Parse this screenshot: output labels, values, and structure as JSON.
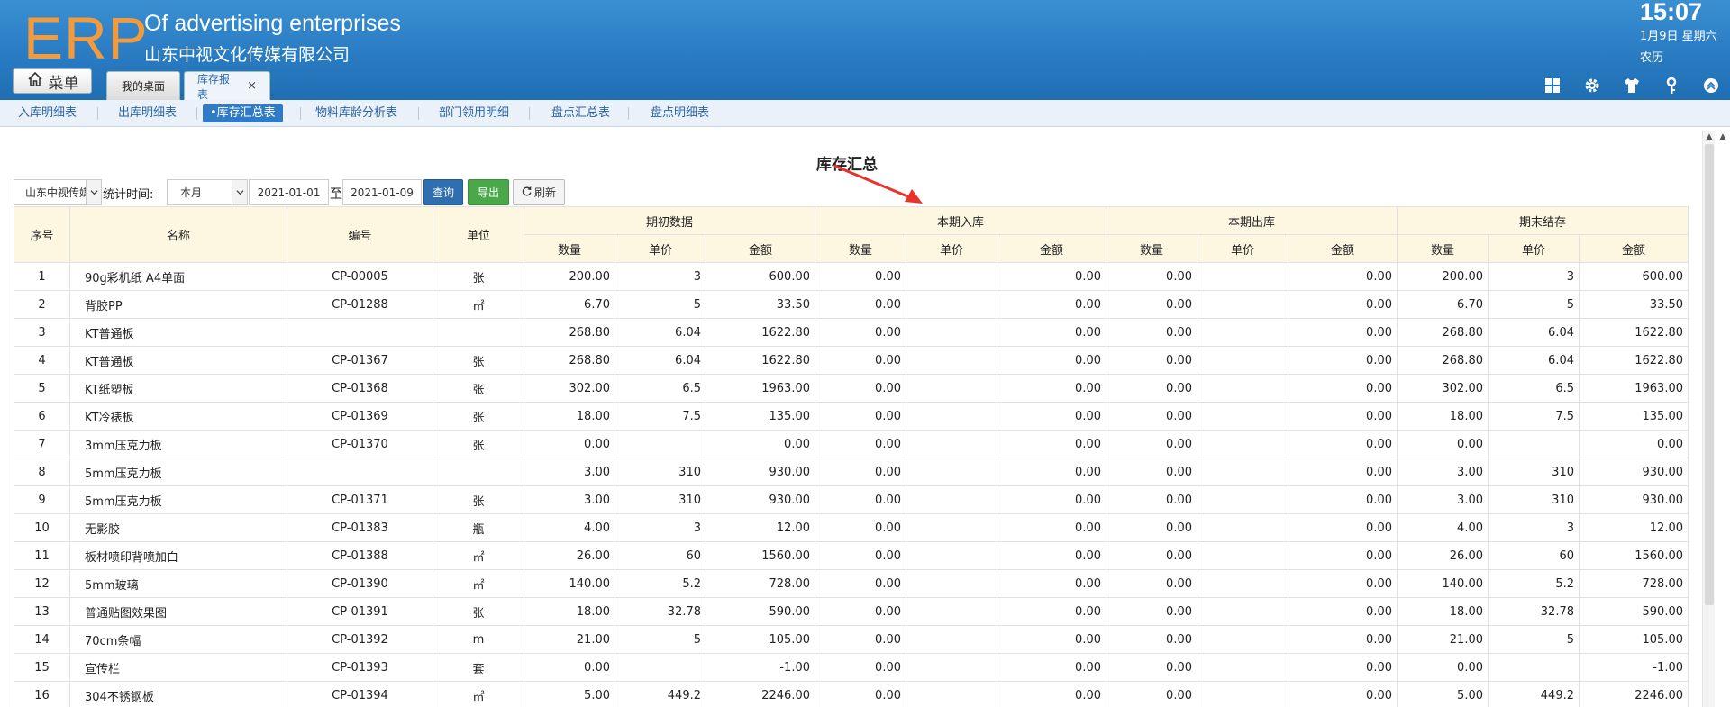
{
  "header": {
    "logo": "ERP",
    "company_en": "Of advertising enterprises",
    "company_cn": "山东中视文化传媒有限公司",
    "time": "15:07",
    "date": "1月9日 星期六",
    "lunar": "农历",
    "menu_label": "菜单",
    "tabs": [
      {
        "label": "我的桌面"
      },
      {
        "label": "库存报表",
        "close": "×"
      }
    ],
    "icons": [
      "grid-icon",
      "gear-icon",
      "shirt-icon",
      "key-icon",
      "collapse-up-icon"
    ]
  },
  "subnav": {
    "items": [
      {
        "label": "入库明细表"
      },
      {
        "label": "出库明细表"
      },
      {
        "label": "•库存汇总表"
      },
      {
        "label": "物料库龄分析表"
      },
      {
        "label": "部门领用明细"
      },
      {
        "label": "盘点汇总表"
      },
      {
        "label": "盘点明细表"
      }
    ]
  },
  "report": {
    "title": "库存汇总",
    "filters": {
      "company": "山东中视传媒",
      "time_label": "统计时间:",
      "period": "本月",
      "date_from": "2021-01-01",
      "to_label": "至",
      "date_to": "2021-01-09"
    },
    "buttons": {
      "query": "查询",
      "export": "导出",
      "refresh": "刷新"
    }
  },
  "table": {
    "headers": {
      "no": "序号",
      "name": "名称",
      "code": "编号",
      "unit": "单位",
      "groups": [
        "期初数据",
        "本期入库",
        "本期出库",
        "期末结存"
      ],
      "sub": [
        "数量",
        "单价",
        "金额"
      ]
    },
    "rows": [
      [
        "1",
        "90g彩机纸 A4单面",
        "CP-00005",
        "张",
        "200.00",
        "3",
        "600.00",
        "0.00",
        "",
        "0.00",
        "0.00",
        "",
        "0.00",
        "200.00",
        "3",
        "600.00"
      ],
      [
        "2",
        "背胶PP",
        "CP-01288",
        "㎡",
        "6.70",
        "5",
        "33.50",
        "0.00",
        "",
        "0.00",
        "0.00",
        "",
        "0.00",
        "6.70",
        "5",
        "33.50"
      ],
      [
        "3",
        "KT普通板",
        "",
        "",
        "268.80",
        "6.04",
        "1622.80",
        "0.00",
        "",
        "0.00",
        "0.00",
        "",
        "0.00",
        "268.80",
        "6.04",
        "1622.80"
      ],
      [
        "4",
        "KT普通板",
        "CP-01367",
        "张",
        "268.80",
        "6.04",
        "1622.80",
        "0.00",
        "",
        "0.00",
        "0.00",
        "",
        "0.00",
        "268.80",
        "6.04",
        "1622.80"
      ],
      [
        "5",
        "KT纸塑板",
        "CP-01368",
        "张",
        "302.00",
        "6.5",
        "1963.00",
        "0.00",
        "",
        "0.00",
        "0.00",
        "",
        "0.00",
        "302.00",
        "6.5",
        "1963.00"
      ],
      [
        "6",
        "KT冷裱板",
        "CP-01369",
        "张",
        "18.00",
        "7.5",
        "135.00",
        "0.00",
        "",
        "0.00",
        "0.00",
        "",
        "0.00",
        "18.00",
        "7.5",
        "135.00"
      ],
      [
        "7",
        "3mm压克力板",
        "CP-01370",
        "张",
        "0.00",
        "",
        "0.00",
        "0.00",
        "",
        "0.00",
        "0.00",
        "",
        "0.00",
        "0.00",
        "",
        "0.00"
      ],
      [
        "8",
        "5mm压克力板",
        "",
        "",
        "3.00",
        "310",
        "930.00",
        "0.00",
        "",
        "0.00",
        "0.00",
        "",
        "0.00",
        "3.00",
        "310",
        "930.00"
      ],
      [
        "9",
        "5mm压克力板",
        "CP-01371",
        "张",
        "3.00",
        "310",
        "930.00",
        "0.00",
        "",
        "0.00",
        "0.00",
        "",
        "0.00",
        "3.00",
        "310",
        "930.00"
      ],
      [
        "10",
        "无影胶",
        "CP-01383",
        "瓶",
        "4.00",
        "3",
        "12.00",
        "0.00",
        "",
        "0.00",
        "0.00",
        "",
        "0.00",
        "4.00",
        "3",
        "12.00"
      ],
      [
        "11",
        "板材喷印背喷加白",
        "CP-01388",
        "㎡",
        "26.00",
        "60",
        "1560.00",
        "0.00",
        "",
        "0.00",
        "0.00",
        "",
        "0.00",
        "26.00",
        "60",
        "1560.00"
      ],
      [
        "12",
        "5mm玻璃",
        "CP-01390",
        "㎡",
        "140.00",
        "5.2",
        "728.00",
        "0.00",
        "",
        "0.00",
        "0.00",
        "",
        "0.00",
        "140.00",
        "5.2",
        "728.00"
      ],
      [
        "13",
        "普通贴图效果图",
        "CP-01391",
        "张",
        "18.00",
        "32.78",
        "590.00",
        "0.00",
        "",
        "0.00",
        "0.00",
        "",
        "0.00",
        "18.00",
        "32.78",
        "590.00"
      ],
      [
        "14",
        "70cm条幅",
        "CP-01392",
        "m",
        "21.00",
        "5",
        "105.00",
        "0.00",
        "",
        "0.00",
        "0.00",
        "",
        "0.00",
        "21.00",
        "5",
        "105.00"
      ],
      [
        "15",
        "宣传栏",
        "CP-01393",
        "套",
        "0.00",
        "",
        "-1.00",
        "0.00",
        "",
        "0.00",
        "0.00",
        "",
        "0.00",
        "0.00",
        "",
        "-1.00"
      ],
      [
        "16",
        "304不锈钢板",
        "CP-01394",
        "㎡",
        "5.00",
        "449.2",
        "2246.00",
        "0.00",
        "",
        "0.00",
        "0.00",
        "",
        "0.00",
        "5.00",
        "449.2",
        "2246.00"
      ]
    ]
  },
  "colors": {
    "header_blue": "#2a7cc2",
    "logo_orange": "#f39a3d",
    "table_header_bg": "#fdf7e2",
    "query_btn": "#2f6fb0",
    "export_btn": "#4aa84a",
    "annotation_arrow": "#e8332a"
  }
}
